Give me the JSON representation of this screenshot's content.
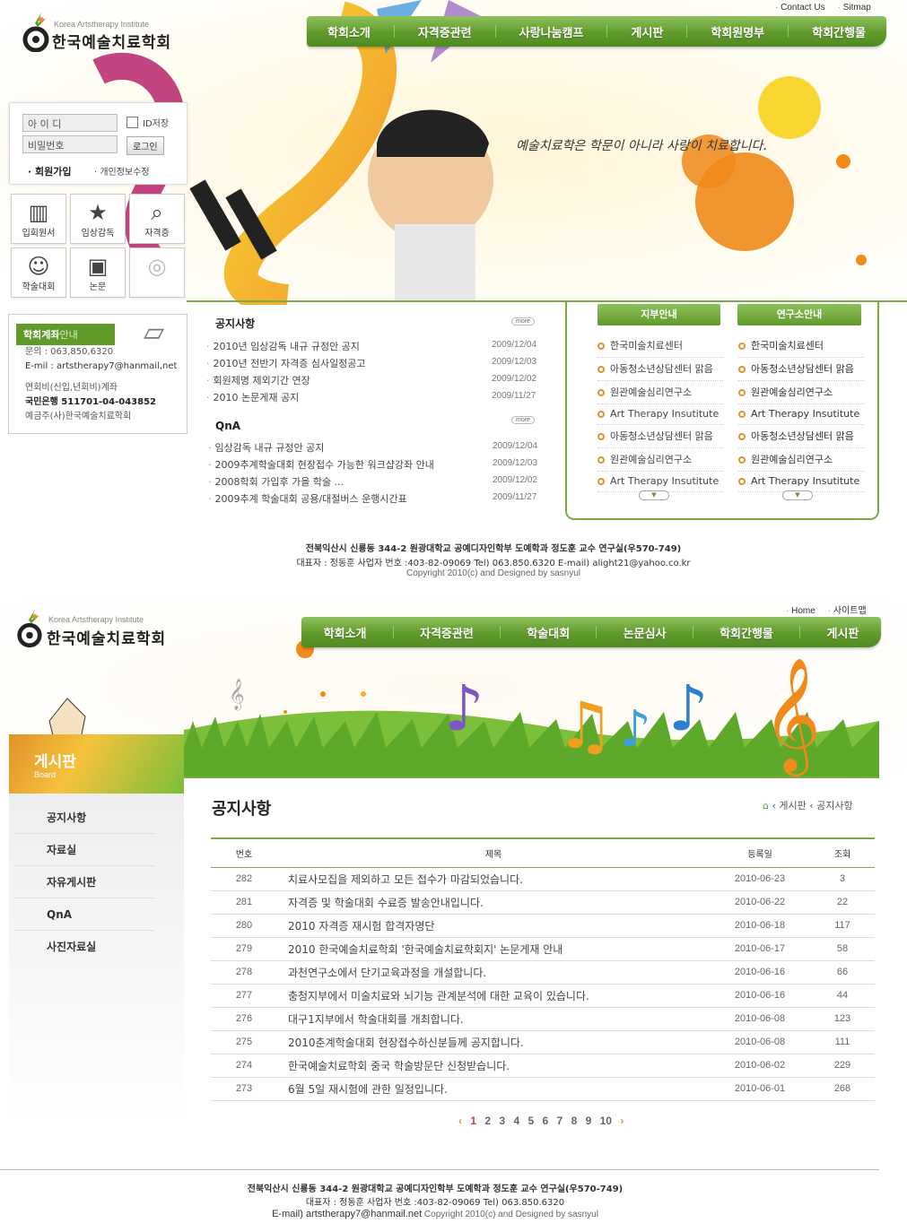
{
  "site": {
    "logo_en": "Korea Artstherapy Institute",
    "logo_ko": "한국예술치료학회"
  },
  "top": {
    "util_links": [
      "Contact Us",
      "Sitmap"
    ],
    "gnav": [
      "학회소개",
      "자격증관련",
      "사랑나눔캠프",
      "게시판",
      "학회원명부",
      "학회간행물"
    ],
    "slogan": "예술치료학은 학문이 아니라 사랑이 치료합니다.",
    "login": {
      "id_placeholder": "아 이 디",
      "pw_placeholder": "비밀번호",
      "save_id": "ID저장",
      "login_button": "로그인",
      "join": "회원가입",
      "edit_info": "개인정보수정"
    },
    "quick": [
      "입회원서",
      "임상감독",
      "자격증",
      "학술대회",
      "논문"
    ],
    "bank": {
      "title_a": "학회계좌",
      "title_b": "안내",
      "phone": "문의 : 063,850,6320",
      "email": "E-mil : artstherapy7@hanmail,net",
      "fees": "연회비(신입,년회비)계좌",
      "account": "국민은행 511701-04-043852",
      "holder": "예금주(사)한국예술치료학회"
    },
    "notice": {
      "title": "공지사항",
      "more": "more",
      "items": [
        {
          "title": "2010년 임상감독 내규 규정안 공지",
          "date": "2009/12/04"
        },
        {
          "title": "2010년 전반기 자격증 심사일정공고",
          "date": "2009/12/03"
        },
        {
          "title": "회원제명 제외기간 연장",
          "date": "2009/12/02"
        },
        {
          "title": "2010 논문게재 공지",
          "date": "2009/11/27"
        }
      ]
    },
    "qna": {
      "title": "QnA",
      "more": "more",
      "items": [
        {
          "title": "임상감독 내규 규정안 공지",
          "date": "2009/12/04"
        },
        {
          "title": "2009추계학술대회 현장접수 가능한 워크샵강좌 안내",
          "date": "2009/12/03"
        },
        {
          "title": "2008학회 가입후 가을 학술 ...",
          "date": "2009/12/02"
        },
        {
          "title": "2009추계 학술대회 공용/대절버스 운행시간표",
          "date": "2009/11/27"
        }
      ]
    },
    "branch": {
      "tab": "지부안내",
      "items": [
        "한국미술치료센터",
        "아동청소년상담센터 맑음",
        "원관예술심리연구소",
        "Art Therapy Insutitute",
        "아동청소년상담센터 맑음",
        "원관예술심리연구소",
        "Art Therapy Insutitute"
      ]
    },
    "institute": {
      "tab": "연구소안내",
      "items": [
        "한국미술치료센터",
        "아동청소년상담센터 맑음",
        "원관예술심리연구소",
        "Art Therapy Insutitute",
        "아동청소년상담센터 맑음",
        "원관예술심리연구소",
        "Art Therapy Insutitute"
      ]
    },
    "footer": {
      "address": "전북익산시 신룡동 344-2 원광대학교 공예디자인학부 도예학과 정도훈 교수 연구실(우570-749)",
      "rep": "대표자 : 정동훈 사업자 번호 :403-82-09069   Tel) 063.850.6320   E-mail) alight21@yahoo.co.kr",
      "copyright": "Copyright 2010(c) and Designed by sasnyul"
    }
  },
  "sub": {
    "util_links": [
      "Home",
      "사이트맵"
    ],
    "gnav": [
      "학회소개",
      "자격증관련",
      "학술대회",
      "논문심사",
      "학회간행물",
      "게시판"
    ],
    "section": {
      "title": "게시판",
      "subtitle": "Board"
    },
    "lnb": [
      "공지사항",
      "자료실",
      "자유게시판",
      "QnA",
      "사진자료실"
    ],
    "page_title": "공지사항",
    "breadcrumb": [
      "게시판",
      "공지사항"
    ],
    "table": {
      "headers": [
        "번호",
        "제목",
        "등록일",
        "조회"
      ],
      "rows": [
        {
          "no": "282",
          "title": "치료사모집을 제외하고 모든 접수가 마감되었습니다.",
          "date": "2010-06-23",
          "views": "3"
        },
        {
          "no": "281",
          "title": "자격증 및 학술대회 수료증 발송안내입니다.",
          "date": "2010-06-22",
          "views": "22"
        },
        {
          "no": "280",
          "title": "2010 자격증 재시험 합격자명단",
          "date": "2010-06-18",
          "views": "117"
        },
        {
          "no": "279",
          "title": "2010 한국예술치료학회 '한국예술치료학회지' 논문게재 안내",
          "date": "2010-06-17",
          "views": "58"
        },
        {
          "no": "278",
          "title": "과천연구소에서 단기교육과정을 개설합니다.",
          "date": "2010-06-16",
          "views": "66"
        },
        {
          "no": "277",
          "title": "충청지부에서 미술치료와 뇌기능 관계분석에 대한 교육이 있습니다.",
          "date": "2010-06-16",
          "views": "44"
        },
        {
          "no": "276",
          "title": "대구1지부에서 학술대회를 개최합니다.",
          "date": "2010-06-08",
          "views": "123"
        },
        {
          "no": "275",
          "title": "2010춘계학술대회 현장접수하신분들께 공지합니다.",
          "date": "2010-06-08",
          "views": "111"
        },
        {
          "no": "274",
          "title": "한국예술치료학회 중국 학술방문단 신청받습니다.",
          "date": "2010-06-02",
          "views": "229"
        },
        {
          "no": "273",
          "title": "6월 5일 재시험에 관한 일정입니다.",
          "date": "2010-06-01",
          "views": "268"
        }
      ]
    },
    "pager": {
      "prev": "‹",
      "pages": [
        "1",
        "2",
        "3",
        "4",
        "5",
        "6",
        "7",
        "8",
        "9",
        "10"
      ],
      "current": "1",
      "next": "›"
    },
    "footer": {
      "address": "전북익산시 신룡동 344-2 원광대학교 공예디자인학부 도예학과 정도훈 교수 연구실(우570-749)",
      "rep": "대표자 : 정동훈 사업자 번호 :403-82-09069   Tel) 063.850.6320",
      "email": "E-mail) artstherapy7@hanmail.net",
      "copyright": "Copyright 2010(c) and Designed by sasnyul"
    }
  },
  "colors": {
    "green": "#5f9a2a",
    "orange": "#e0932a",
    "red": "#d33"
  }
}
